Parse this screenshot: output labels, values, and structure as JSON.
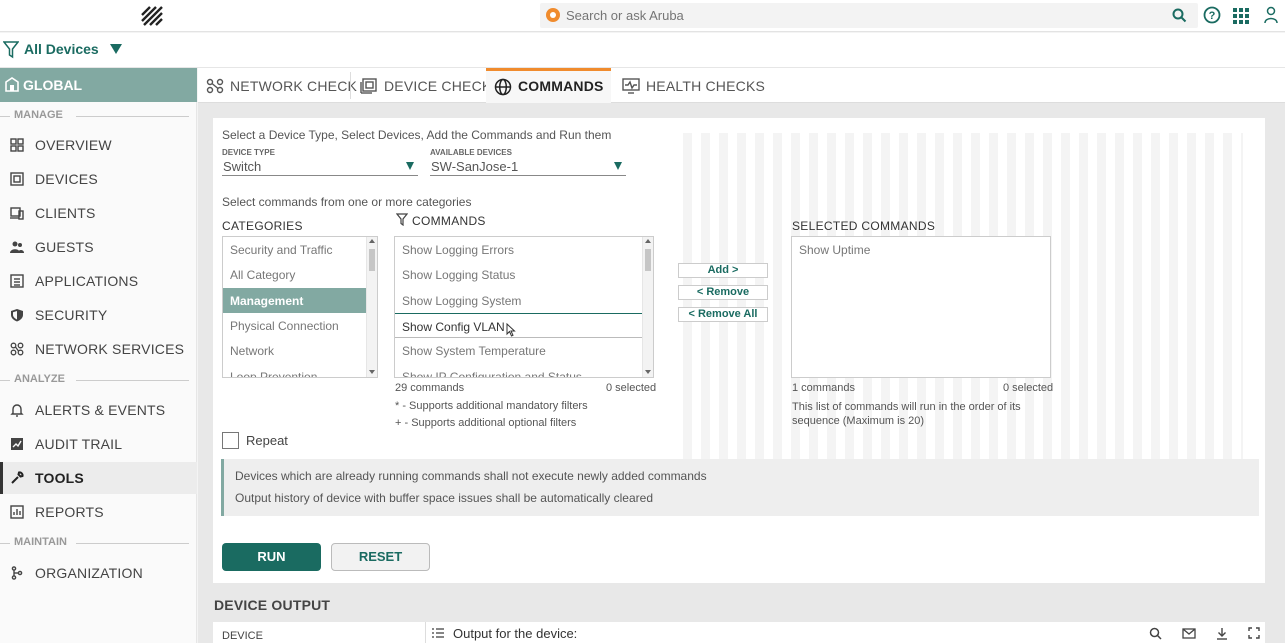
{
  "search": {
    "placeholder": "Search or ask Aruba"
  },
  "filter": {
    "label": "All Devices"
  },
  "sidebar": {
    "global_label": "GLOBAL",
    "sections": {
      "manage": "MANAGE",
      "analyze": "ANALYZE",
      "maintain": "MAINTAIN"
    },
    "items": [
      {
        "label": "OVERVIEW"
      },
      {
        "label": "DEVICES"
      },
      {
        "label": "CLIENTS"
      },
      {
        "label": "GUESTS"
      },
      {
        "label": "APPLICATIONS"
      },
      {
        "label": "SECURITY"
      },
      {
        "label": "NETWORK SERVICES"
      },
      {
        "label": "ALERTS & EVENTS"
      },
      {
        "label": "AUDIT TRAIL"
      },
      {
        "label": "TOOLS"
      },
      {
        "label": "REPORTS"
      },
      {
        "label": "ORGANIZATION"
      }
    ]
  },
  "tabs": [
    {
      "label": "NETWORK CHECK"
    },
    {
      "label": "DEVICE CHECK"
    },
    {
      "label": "COMMANDS"
    },
    {
      "label": "HEALTH CHECKS"
    }
  ],
  "commands_form": {
    "intro": "Select a Device Type, Select Devices, Add the Commands and Run them",
    "device_type_label": "DEVICE TYPE",
    "device_type_value": "Switch",
    "available_devices_label": "AVAILABLE DEVICES",
    "available_devices_value": "SW-SanJose-1",
    "categories_intro": "Select commands from one or more categories",
    "categories_header": "CATEGORIES",
    "categories": [
      "Security and Traffic",
      "All Category",
      "Management",
      "Physical Connection",
      "Network",
      "Loop Prevention"
    ],
    "commands_header": "COMMANDS",
    "commands": [
      "Show Logging Errors",
      "Show Logging Status",
      "Show Logging System",
      "Show Config VLAN",
      "Show System Temperature",
      "Show IP Configuration and Status"
    ],
    "commands_count": "29 commands",
    "commands_selected": "0 selected",
    "note_mandatory": "* - Supports additional mandatory filters",
    "note_optional": "+ - Supports additional optional filters",
    "add_btn": "Add >",
    "remove_btn": "< Remove",
    "remove_all_btn": "< Remove All",
    "selected_header": "SELECTED COMMANDS",
    "selected": [
      "Show Uptime"
    ],
    "selected_count": "1 commands",
    "selected_selected": "0 selected",
    "selected_note": "This list of commands will run in the order of its sequence (Maximum is 20)",
    "repeat_label": "Repeat",
    "info_line1": "Devices which are already running commands shall not execute newly added commands",
    "info_line2": "Output history of device with buffer space issues shall be automatically cleared",
    "run_btn": "RUN",
    "reset_btn": "RESET"
  },
  "device_output": {
    "title": "DEVICE OUTPUT",
    "device_col": "DEVICE",
    "output_title": "Output for the device:"
  }
}
